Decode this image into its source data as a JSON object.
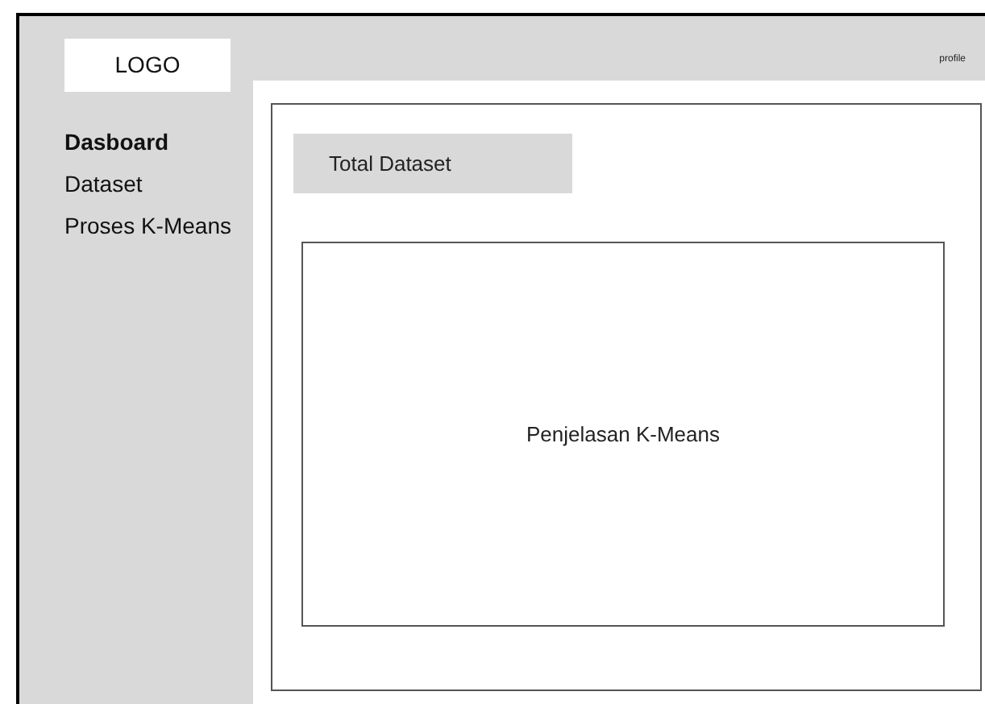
{
  "logo": "LOGO",
  "sidebar": {
    "items": [
      {
        "label": "Dasboard",
        "selected": true
      },
      {
        "label": "Dataset",
        "selected": false
      },
      {
        "label": "Proses K-Means",
        "selected": false
      }
    ]
  },
  "header": {
    "profile": "profile"
  },
  "main": {
    "total_card": "Total Dataset",
    "explanation": "Penjelasan K-Means"
  }
}
